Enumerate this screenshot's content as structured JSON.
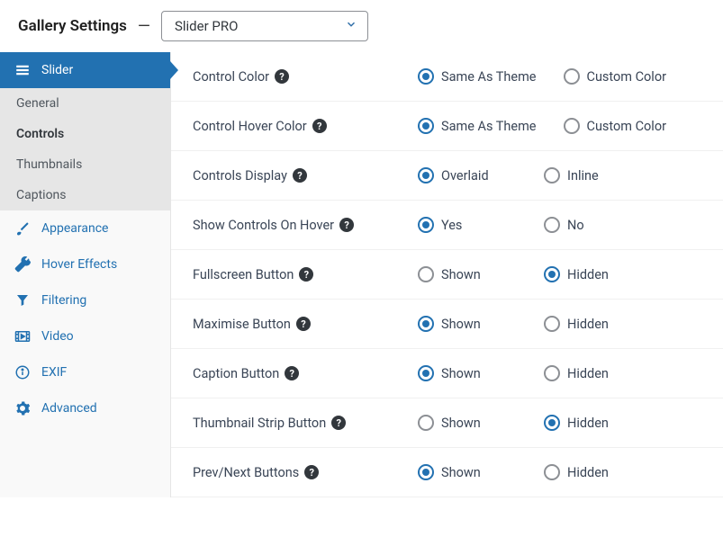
{
  "header": {
    "title": "Gallery Settings",
    "select_value": "Slider PRO"
  },
  "sidebar": {
    "items": [
      {
        "label": "Slider",
        "icon": "slider"
      },
      {
        "label": "Appearance",
        "icon": "brush"
      },
      {
        "label": "Hover Effects",
        "icon": "wrench"
      },
      {
        "label": "Filtering",
        "icon": "filter"
      },
      {
        "label": "Video",
        "icon": "video"
      },
      {
        "label": "EXIF",
        "icon": "info"
      },
      {
        "label": "Advanced",
        "icon": "gear"
      }
    ],
    "sub_items": [
      {
        "label": "General"
      },
      {
        "label": "Controls"
      },
      {
        "label": "Thumbnails"
      },
      {
        "label": "Captions"
      }
    ]
  },
  "settings": [
    {
      "label": "Control Color",
      "options": [
        "Same As Theme",
        "Custom Color"
      ],
      "selected": 0
    },
    {
      "label": "Control Hover Color",
      "options": [
        "Same As Theme",
        "Custom Color"
      ],
      "selected": 0
    },
    {
      "label": "Controls Display",
      "options": [
        "Overlaid",
        "Inline"
      ],
      "selected": 0
    },
    {
      "label": "Show Controls On Hover",
      "options": [
        "Yes",
        "No"
      ],
      "selected": 0
    },
    {
      "label": "Fullscreen Button",
      "options": [
        "Shown",
        "Hidden"
      ],
      "selected": 1
    },
    {
      "label": "Maximise Button",
      "options": [
        "Shown",
        "Hidden"
      ],
      "selected": 0
    },
    {
      "label": "Caption Button",
      "options": [
        "Shown",
        "Hidden"
      ],
      "selected": 0
    },
    {
      "label": "Thumbnail Strip Button",
      "options": [
        "Shown",
        "Hidden"
      ],
      "selected": 1
    },
    {
      "label": "Prev/Next Buttons",
      "options": [
        "Shown",
        "Hidden"
      ],
      "selected": 0
    }
  ]
}
